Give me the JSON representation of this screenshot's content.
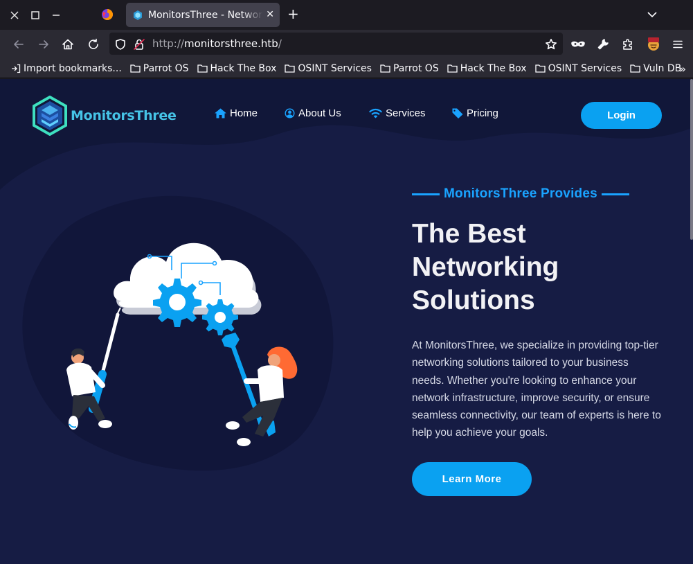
{
  "browser": {
    "tab_title": "MonitorsThree - Network",
    "url_protocol": "http://",
    "url_host": "monitorsthree.htb",
    "url_path": "/",
    "bookmarks": [
      {
        "label": "Import bookmarks..."
      },
      {
        "label": "Parrot OS"
      },
      {
        "label": "Hack The Box"
      },
      {
        "label": "OSINT Services"
      },
      {
        "label": "Parrot OS"
      },
      {
        "label": "Hack The Box"
      },
      {
        "label": "OSINT Services"
      },
      {
        "label": "Vuln DB"
      }
    ]
  },
  "site": {
    "brand": "MonitorsThree",
    "nav": {
      "home": "Home",
      "about": "About Us",
      "services": "Services",
      "pricing": "Pricing",
      "login": "Login"
    },
    "hero": {
      "eyebrow": "MonitorsThree Provides",
      "headline": "The Best Networking Solutions",
      "description": "At MonitorsThree, we specialize in providing top-tier networking solutions tailored to your business needs. Whether you're looking to enhance your network infrastructure, improve security, or ensure seamless connectivity, our team of experts is here to help you achieve your goals.",
      "cta": "Learn More"
    }
  },
  "colors": {
    "page_bg": "#161c44",
    "accent": "#0aa1f1",
    "brand_text": "#46c3e6",
    "chrome_bg": "#2b2a33"
  }
}
